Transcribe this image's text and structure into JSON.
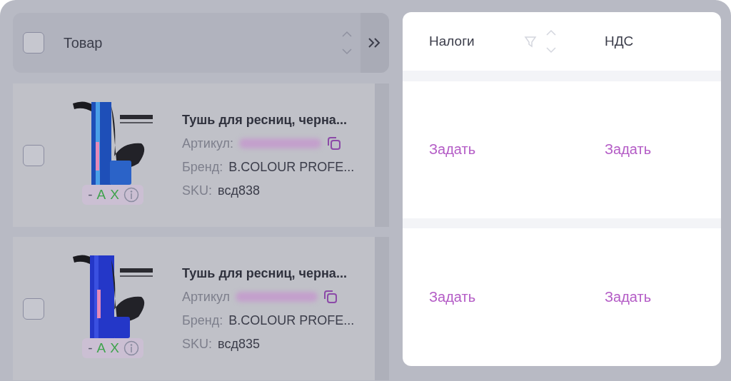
{
  "products": {
    "header": {
      "checked": false,
      "column": "Товар"
    },
    "rows": [
      {
        "checked": false,
        "title": "Тушь для ресниц, черна...",
        "article_label": "Артикул:",
        "brand_label": "Бренд:",
        "brand": "B.COLOUR PROFE...",
        "sku_label": "SKU:",
        "sku": "всд838",
        "grades": [
          {
            "text": "-",
            "color": "#55576a"
          },
          {
            "text": "A",
            "color": "#3fa34d"
          },
          {
            "text": "X",
            "color": "#3fa34d"
          }
        ]
      },
      {
        "checked": false,
        "title": "Тушь для ресниц, черна...",
        "article_label": "Артикул",
        "brand_label": "Бренд:",
        "brand": "B.COLOUR PROFE...",
        "sku_label": "SKU:",
        "sku": "всд835",
        "grades": [
          {
            "text": "-",
            "color": "#55576a"
          },
          {
            "text": "A",
            "color": "#3fa34d"
          },
          {
            "text": "X",
            "color": "#3fa34d"
          }
        ]
      }
    ]
  },
  "tax_panel": {
    "columns": [
      {
        "label": "Налоги",
        "sortable": true
      },
      {
        "label": "НДС",
        "sortable": false
      }
    ],
    "rows": [
      [
        "Задать",
        "Задать"
      ],
      [
        "Задать",
        "Задать"
      ]
    ]
  }
}
